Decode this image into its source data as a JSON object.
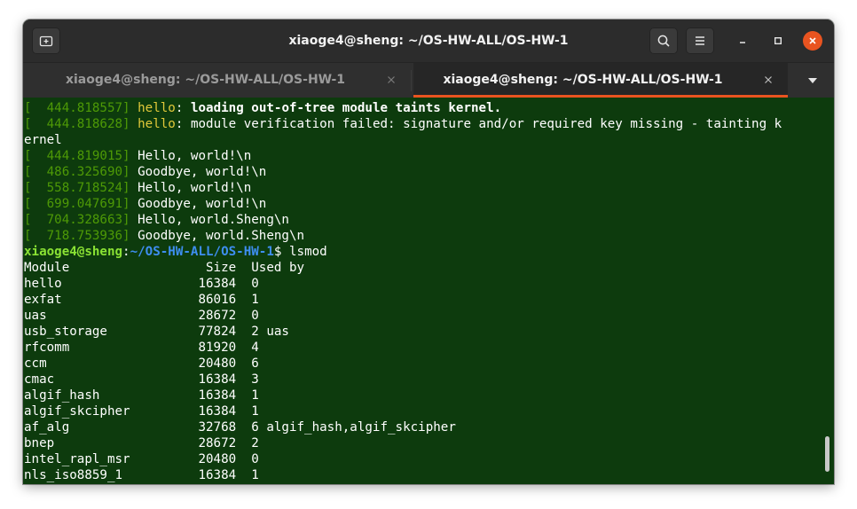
{
  "window": {
    "title": "xiaoge4@sheng: ~/OS-HW-ALL/OS-HW-1",
    "accent_color": "#e95420",
    "terminal_bg": "#0d3b0d"
  },
  "tabs": [
    {
      "label": "xiaoge4@sheng: ~/OS-HW-ALL/OS-HW-1",
      "active": false
    },
    {
      "label": "xiaoge4@sheng: ~/OS-HW-ALL/OS-HW-1",
      "active": true
    }
  ],
  "icons": {
    "new_tab": "new-tab-icon",
    "search": "search-icon",
    "menu": "hamburger-menu-icon",
    "minimize": "minimize-icon",
    "maximize": "maximize-icon",
    "close": "close-icon",
    "tab_close": "tab-close-icon",
    "tab_list": "chevron-down-icon"
  },
  "terminal": {
    "dmesg": [
      {
        "ts": "[  444.818557]",
        "src": "hello",
        "msg": "loading out-of-tree module taints kernel."
      },
      {
        "ts": "[  444.818628]",
        "src": "hello",
        "msg": "module verification failed: signature and/or required key missing - tainting k",
        "cont": "ernel"
      },
      {
        "ts": "[  444.819015]",
        "msg": "Hello, world!\\n"
      },
      {
        "ts": "[  486.325690]",
        "msg": "Goodbye, world!\\n"
      },
      {
        "ts": "[  558.718524]",
        "msg": "Hello, world!\\n"
      },
      {
        "ts": "[  699.047691]",
        "msg": "Goodbye, world!\\n"
      },
      {
        "ts": "[  704.328663]",
        "msg": "Hello, world.Sheng\\n"
      },
      {
        "ts": "[  718.753936]",
        "msg": "Goodbye, world.Sheng\\n"
      }
    ],
    "prompt": {
      "user": "xiaoge4@sheng",
      "sep": ":",
      "path": "~/OS-HW-ALL/OS-HW-1",
      "symbol": "$ ",
      "command": "lsmod"
    },
    "lsmod_header": "Module                  Size  Used by",
    "lsmod_rows": [
      "hello                  16384  0",
      "exfat                  86016  1",
      "uas                    28672  0",
      "usb_storage            77824  2 uas",
      "rfcomm                 81920  4",
      "ccm                    20480  6",
      "cmac                   16384  3",
      "algif_hash             16384  1",
      "algif_skcipher         16384  1",
      "af_alg                 32768  6 algif_hash,algif_skcipher",
      "bnep                   28672  2",
      "intel_rapl_msr         20480  0",
      "nls_iso8859_1          16384  1"
    ]
  }
}
